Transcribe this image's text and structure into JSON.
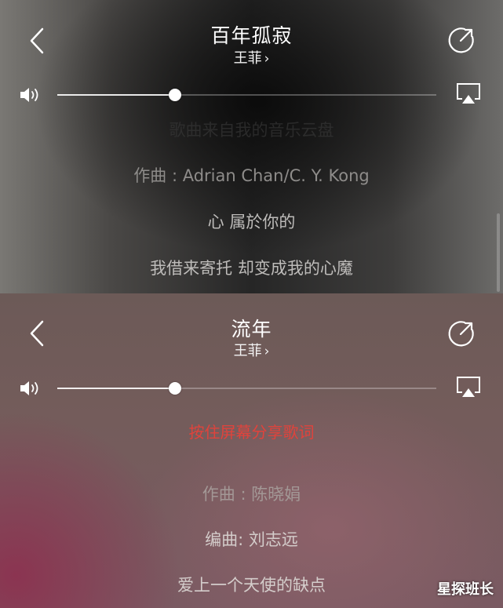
{
  "screens": [
    {
      "title": "百年孤寂",
      "artist": "王菲",
      "chevron": "›",
      "volume_level": 0.31,
      "icons": [
        "back-chevron-icon",
        "share-icon",
        "volume-icon",
        "airplay-icon"
      ],
      "lyrics": {
        "faded_top": "歌曲来自我的音乐云盘",
        "composer": "作曲 : Adrian Chan/C. Y. Kong",
        "line1": "心 属於你的",
        "line2": "我借来寄托 却变成我的心魔"
      }
    },
    {
      "title": "流年",
      "artist": "王菲",
      "chevron": "›",
      "volume_level": 0.31,
      "icons": [
        "back-chevron-icon",
        "share-icon",
        "volume-icon",
        "airplay-icon"
      ],
      "hint": "按住屏幕分享歌词",
      "lyrics": {
        "composer": "作曲 : 陈晓娟",
        "arranger": "编曲:  刘志远",
        "line1": "爱上一个天使的缺点"
      }
    }
  ],
  "colors": {
    "hint_red": "#e0433c",
    "lyric_dim": "#9a9896",
    "lyric_normal": "#d6d4d2"
  },
  "watermark": "星探班长"
}
